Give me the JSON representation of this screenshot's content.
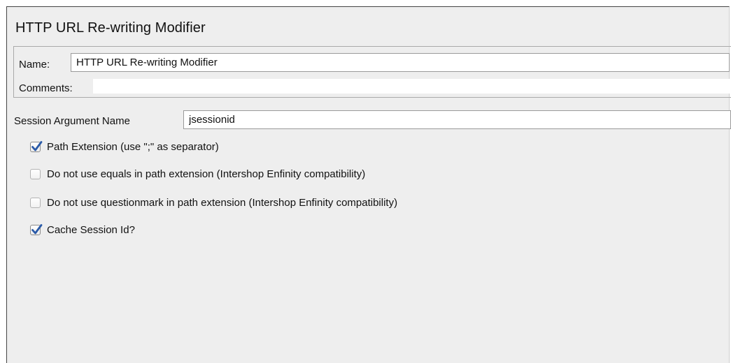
{
  "panel": {
    "title": "HTTP URL Re-writing Modifier"
  },
  "name_field": {
    "label": "Name:",
    "value": "HTTP URL Re-writing Modifier"
  },
  "comments_field": {
    "label": "Comments:",
    "value": ""
  },
  "session_argument": {
    "label": "Session Argument Name",
    "value": "jsessionid"
  },
  "options": [
    {
      "label": "Path Extension (use \";\" as separator)",
      "checked": true
    },
    {
      "label": "Do not use equals in path extension (Intershop Enfinity compatibility)",
      "checked": false
    },
    {
      "label": "Do not use questionmark in path extension (Intershop Enfinity compatibility)",
      "checked": false
    },
    {
      "label": "Cache Session Id?",
      "checked": true
    }
  ],
  "colors": {
    "checkmark": "#2a5aa8",
    "panel_background": "#eeeeee"
  }
}
